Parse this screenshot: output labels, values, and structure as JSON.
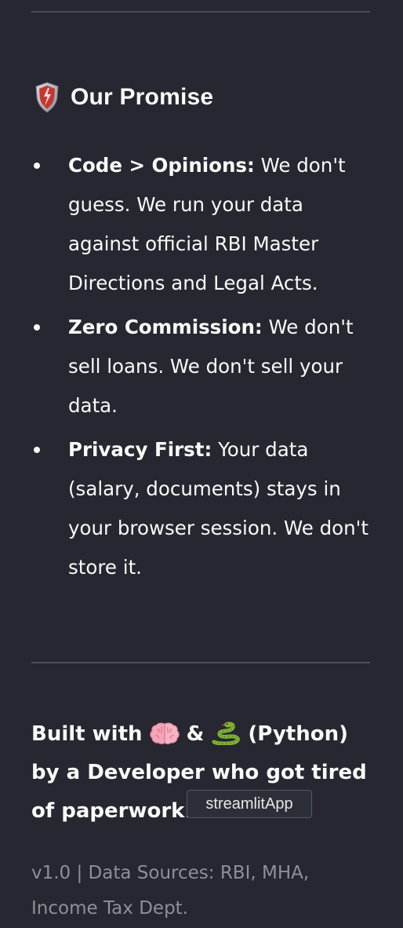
{
  "promise": {
    "icon": "shield-icon",
    "title": "Our Promise",
    "items": [
      {
        "bold": "Code > Opinions:",
        "text": " We don't guess. We run your data against official RBI Master Directions and Legal Acts."
      },
      {
        "bold": "Zero Commission:",
        "text": " We don't sell loans. We don't sell your data."
      },
      {
        "bold": "Privacy First:",
        "text": " Your data (salary, documents) stays in your browser session. We don't store it."
      }
    ]
  },
  "built_with": {
    "part1": "Built with ",
    "brain_icon": "brain-emoji-icon",
    "part2": " & ",
    "snake_icon": "snake-emoji-icon",
    "part3": " (Python) by a Developer who got tired of paperwork."
  },
  "tooltip": {
    "text": "streamlitApp"
  },
  "footer": {
    "text": "v1.0 | Data Sources: RBI, MHA, Income Tax Dept."
  },
  "colors": {
    "background": "#262730",
    "text": "#fafafa",
    "muted": "#8e9099",
    "divider": "#4a4c57"
  }
}
